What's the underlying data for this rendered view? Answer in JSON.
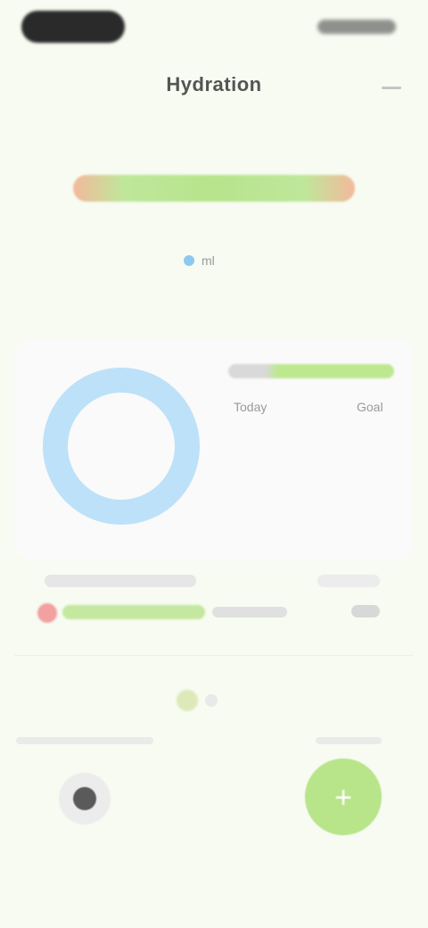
{
  "status_bar": {},
  "header": {
    "title": "Hydration"
  },
  "goal": {
    "label": "",
    "colors": {
      "accent_green": "#b8e48c",
      "accent_orange": "#f3b99c",
      "accent_blue": "#8cc9f2"
    }
  },
  "unit": {
    "label": "ml"
  },
  "summary": {
    "labels": [
      "Today",
      "Goal"
    ]
  },
  "progress_row": {},
  "actions": {
    "add_symbol": "+"
  },
  "icons": {
    "menu": "menu-icon",
    "drop": "water-drop-icon",
    "camera": "camera-icon",
    "add": "plus-icon"
  }
}
